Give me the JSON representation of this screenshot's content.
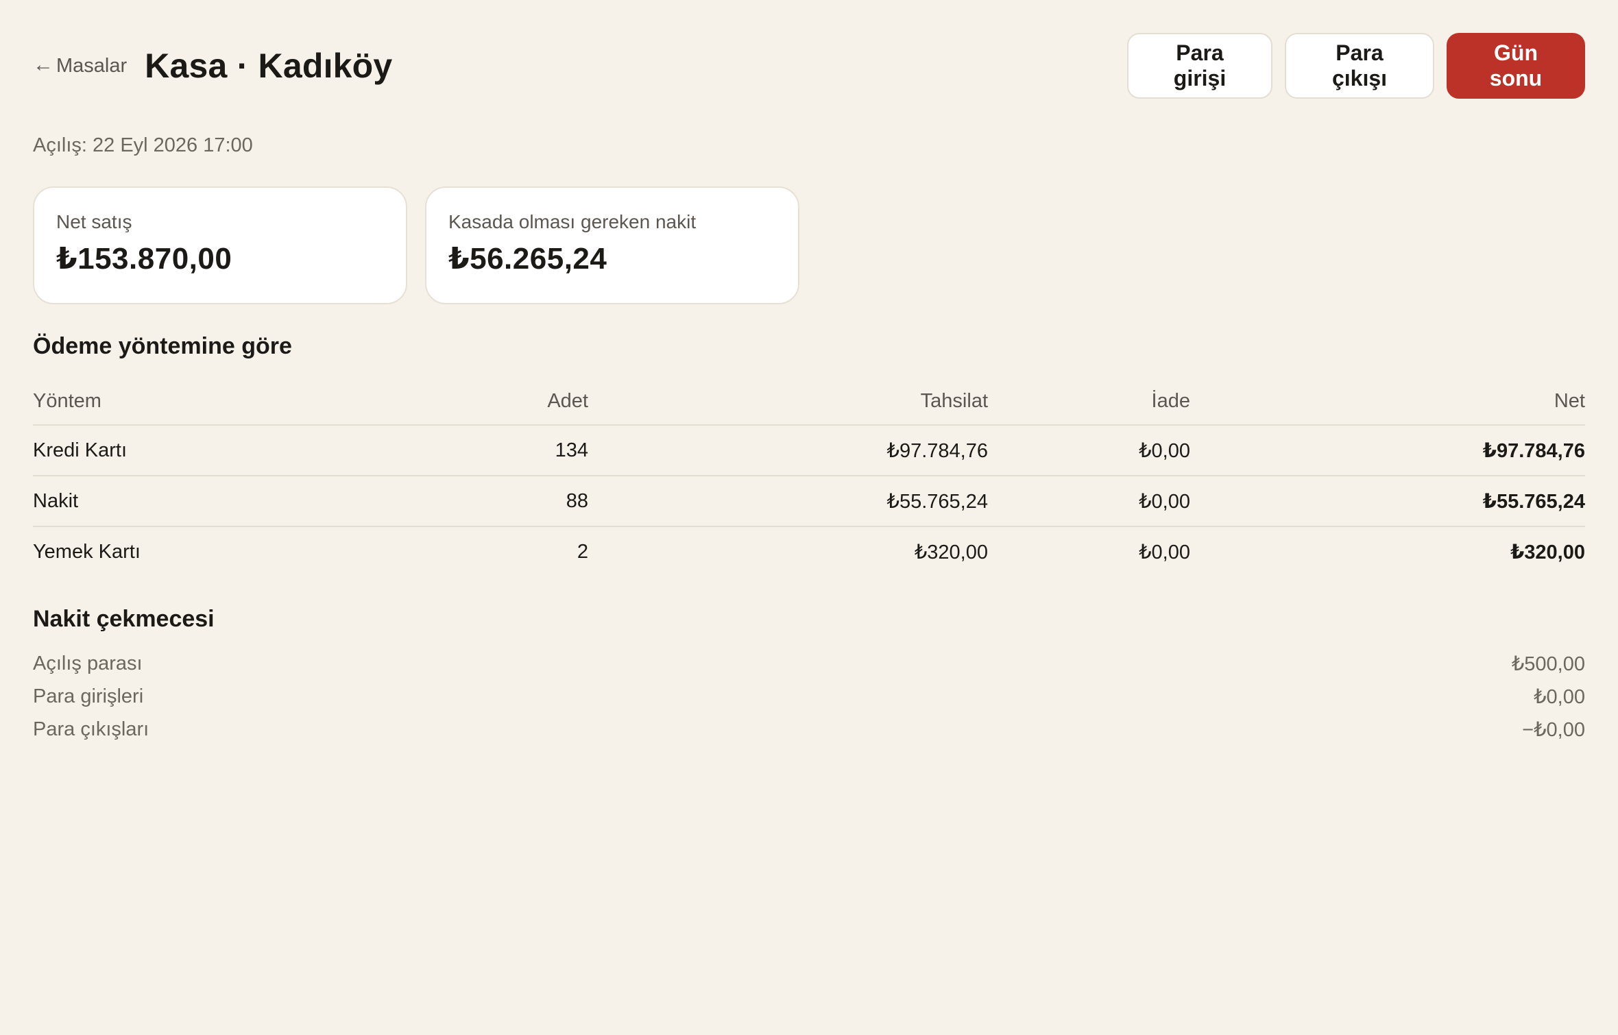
{
  "header": {
    "back_label": "Masalar",
    "title": "Kasa · Kadıköy",
    "actions": {
      "cash_in": "Para girişi",
      "cash_out": "Para çıkışı",
      "end_of_day": "Gün sonu"
    }
  },
  "opened_text": "Açılış: 22 Eyl 2026 17:00",
  "summary": {
    "net_sales_label": "Net satış",
    "net_sales_value": "₺153.870,00",
    "expected_cash_label": "Kasada olması gereken nakit",
    "expected_cash_value": "₺56.265,24"
  },
  "payments": {
    "title": "Ödeme yöntemine göre",
    "columns": [
      "Yöntem",
      "Adet",
      "Tahsilat",
      "İade",
      "Net"
    ],
    "rows": [
      [
        "Kredi Kartı",
        "134",
        "₺97.784,76",
        "₺0,00",
        "₺97.784,76"
      ],
      [
        "Nakit",
        "88",
        "₺55.765,24",
        "₺0,00",
        "₺55.765,24"
      ],
      [
        "Yemek Kartı",
        "2",
        "₺320,00",
        "₺0,00",
        "₺320,00"
      ]
    ]
  },
  "drawer": {
    "title": "Nakit çekmecesi",
    "rows": [
      [
        "Açılış parası",
        "₺500,00"
      ],
      [
        "Para girişleri",
        "₺0,00"
      ],
      [
        "Para çıkışları",
        "−₺0,00"
      ]
    ]
  },
  "colors": {
    "background": "#f6f2ea",
    "accent": "#bd3228"
  }
}
